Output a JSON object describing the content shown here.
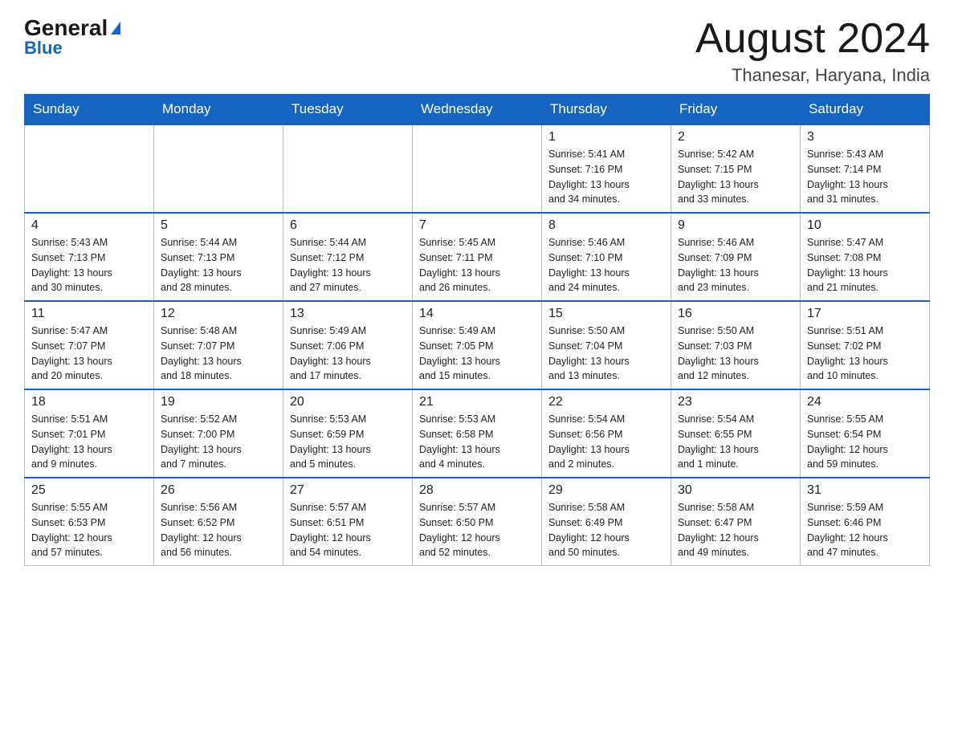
{
  "header": {
    "logo_general": "General",
    "logo_blue": "Blue",
    "month_title": "August 2024",
    "location": "Thanesar, Haryana, India"
  },
  "days_header": [
    "Sunday",
    "Monday",
    "Tuesday",
    "Wednesday",
    "Thursday",
    "Friday",
    "Saturday"
  ],
  "weeks": [
    [
      {
        "day": "",
        "info": ""
      },
      {
        "day": "",
        "info": ""
      },
      {
        "day": "",
        "info": ""
      },
      {
        "day": "",
        "info": ""
      },
      {
        "day": "1",
        "info": "Sunrise: 5:41 AM\nSunset: 7:16 PM\nDaylight: 13 hours\nand 34 minutes."
      },
      {
        "day": "2",
        "info": "Sunrise: 5:42 AM\nSunset: 7:15 PM\nDaylight: 13 hours\nand 33 minutes."
      },
      {
        "day": "3",
        "info": "Sunrise: 5:43 AM\nSunset: 7:14 PM\nDaylight: 13 hours\nand 31 minutes."
      }
    ],
    [
      {
        "day": "4",
        "info": "Sunrise: 5:43 AM\nSunset: 7:13 PM\nDaylight: 13 hours\nand 30 minutes."
      },
      {
        "day": "5",
        "info": "Sunrise: 5:44 AM\nSunset: 7:13 PM\nDaylight: 13 hours\nand 28 minutes."
      },
      {
        "day": "6",
        "info": "Sunrise: 5:44 AM\nSunset: 7:12 PM\nDaylight: 13 hours\nand 27 minutes."
      },
      {
        "day": "7",
        "info": "Sunrise: 5:45 AM\nSunset: 7:11 PM\nDaylight: 13 hours\nand 26 minutes."
      },
      {
        "day": "8",
        "info": "Sunrise: 5:46 AM\nSunset: 7:10 PM\nDaylight: 13 hours\nand 24 minutes."
      },
      {
        "day": "9",
        "info": "Sunrise: 5:46 AM\nSunset: 7:09 PM\nDaylight: 13 hours\nand 23 minutes."
      },
      {
        "day": "10",
        "info": "Sunrise: 5:47 AM\nSunset: 7:08 PM\nDaylight: 13 hours\nand 21 minutes."
      }
    ],
    [
      {
        "day": "11",
        "info": "Sunrise: 5:47 AM\nSunset: 7:07 PM\nDaylight: 13 hours\nand 20 minutes."
      },
      {
        "day": "12",
        "info": "Sunrise: 5:48 AM\nSunset: 7:07 PM\nDaylight: 13 hours\nand 18 minutes."
      },
      {
        "day": "13",
        "info": "Sunrise: 5:49 AM\nSunset: 7:06 PM\nDaylight: 13 hours\nand 17 minutes."
      },
      {
        "day": "14",
        "info": "Sunrise: 5:49 AM\nSunset: 7:05 PM\nDaylight: 13 hours\nand 15 minutes."
      },
      {
        "day": "15",
        "info": "Sunrise: 5:50 AM\nSunset: 7:04 PM\nDaylight: 13 hours\nand 13 minutes."
      },
      {
        "day": "16",
        "info": "Sunrise: 5:50 AM\nSunset: 7:03 PM\nDaylight: 13 hours\nand 12 minutes."
      },
      {
        "day": "17",
        "info": "Sunrise: 5:51 AM\nSunset: 7:02 PM\nDaylight: 13 hours\nand 10 minutes."
      }
    ],
    [
      {
        "day": "18",
        "info": "Sunrise: 5:51 AM\nSunset: 7:01 PM\nDaylight: 13 hours\nand 9 minutes."
      },
      {
        "day": "19",
        "info": "Sunrise: 5:52 AM\nSunset: 7:00 PM\nDaylight: 13 hours\nand 7 minutes."
      },
      {
        "day": "20",
        "info": "Sunrise: 5:53 AM\nSunset: 6:59 PM\nDaylight: 13 hours\nand 5 minutes."
      },
      {
        "day": "21",
        "info": "Sunrise: 5:53 AM\nSunset: 6:58 PM\nDaylight: 13 hours\nand 4 minutes."
      },
      {
        "day": "22",
        "info": "Sunrise: 5:54 AM\nSunset: 6:56 PM\nDaylight: 13 hours\nand 2 minutes."
      },
      {
        "day": "23",
        "info": "Sunrise: 5:54 AM\nSunset: 6:55 PM\nDaylight: 13 hours\nand 1 minute."
      },
      {
        "day": "24",
        "info": "Sunrise: 5:55 AM\nSunset: 6:54 PM\nDaylight: 12 hours\nand 59 minutes."
      }
    ],
    [
      {
        "day": "25",
        "info": "Sunrise: 5:55 AM\nSunset: 6:53 PM\nDaylight: 12 hours\nand 57 minutes."
      },
      {
        "day": "26",
        "info": "Sunrise: 5:56 AM\nSunset: 6:52 PM\nDaylight: 12 hours\nand 56 minutes."
      },
      {
        "day": "27",
        "info": "Sunrise: 5:57 AM\nSunset: 6:51 PM\nDaylight: 12 hours\nand 54 minutes."
      },
      {
        "day": "28",
        "info": "Sunrise: 5:57 AM\nSunset: 6:50 PM\nDaylight: 12 hours\nand 52 minutes."
      },
      {
        "day": "29",
        "info": "Sunrise: 5:58 AM\nSunset: 6:49 PM\nDaylight: 12 hours\nand 50 minutes."
      },
      {
        "day": "30",
        "info": "Sunrise: 5:58 AM\nSunset: 6:47 PM\nDaylight: 12 hours\nand 49 minutes."
      },
      {
        "day": "31",
        "info": "Sunrise: 5:59 AM\nSunset: 6:46 PM\nDaylight: 12 hours\nand 47 minutes."
      }
    ]
  ]
}
